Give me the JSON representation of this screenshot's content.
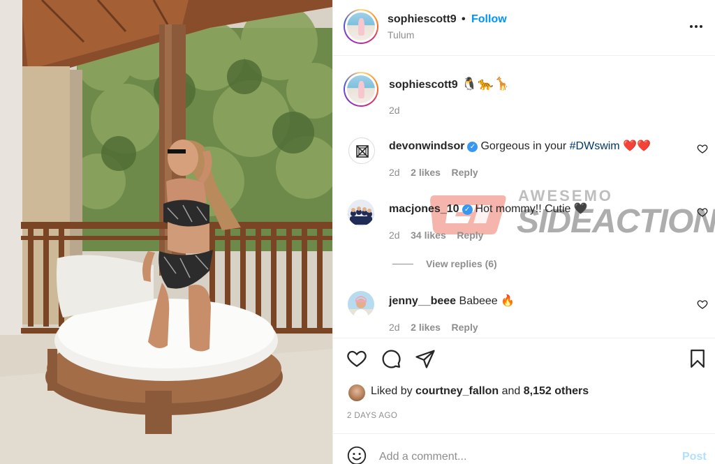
{
  "post": {
    "author": "sophiescott9",
    "separator": "•",
    "follow_label": "Follow",
    "location": "Tulum",
    "more_icon": "more-horizontal-icon",
    "caption_emojis": "🐧🐆🦒",
    "caption_time": "2d"
  },
  "comments": [
    {
      "user": "devonwindsor",
      "verified": true,
      "text_before": "Gorgeous in your ",
      "hashtag": "#DWswim",
      "text_after": " ❤️❤️",
      "time": "2d",
      "likes": "2 likes",
      "reply": "Reply"
    },
    {
      "user": "macjones_10",
      "verified": true,
      "text_before": "Hot mommy!! Cutie 🖤",
      "hashtag": "",
      "text_after": "",
      "time": "2d",
      "likes": "34 likes",
      "reply": "Reply"
    },
    {
      "user": "jenny__beee",
      "verified": false,
      "text_before": "Babeee 🔥",
      "hashtag": "",
      "text_after": "",
      "time": "2d",
      "likes": "2 likes",
      "reply": "Reply"
    }
  ],
  "view_replies": "View replies (6)",
  "watermark": {
    "top": "AWESEMO",
    "bottom": "SIDEACTION"
  },
  "likes": {
    "prefix": "Liked by ",
    "user": "courtney_fallon",
    "middle": " and ",
    "count": "8,152 others"
  },
  "date": "2 DAYS AGO",
  "comment_box": {
    "placeholder": "Add a comment...",
    "post_label": "Post"
  },
  "colors": {
    "follow": "#0095f6",
    "post_disabled": "#b2dffc",
    "muted": "#8e8e8e",
    "heart_red": "#ed4956"
  }
}
